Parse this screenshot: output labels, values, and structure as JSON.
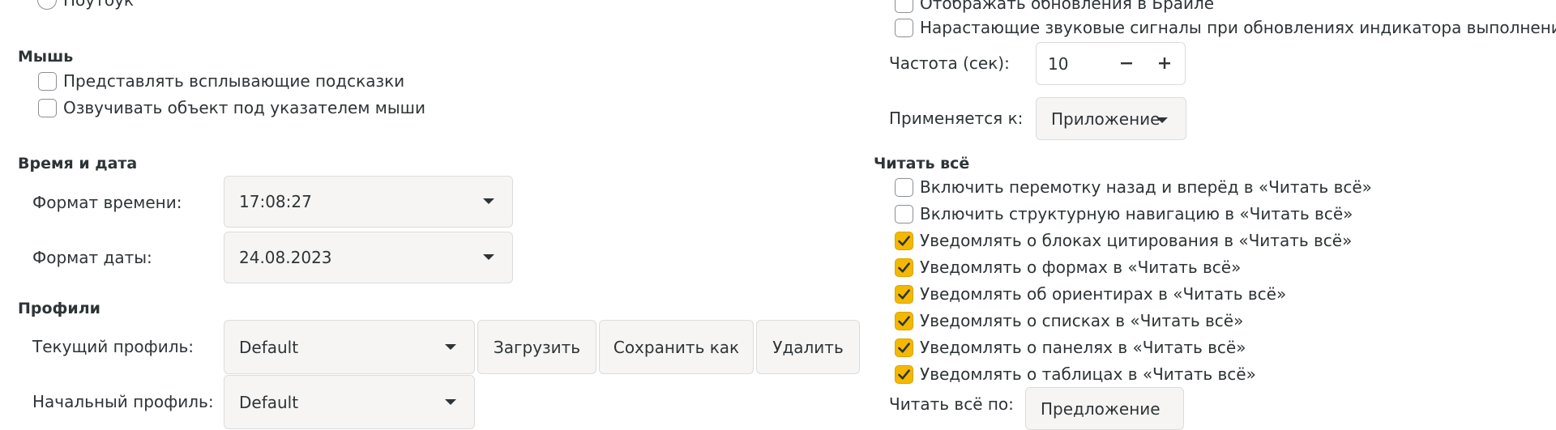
{
  "left": {
    "laptop_radio_label": "Ноутбук",
    "mouse": {
      "heading": "Мышь",
      "tooltips_label": "Представлять всплывающие подсказки",
      "speak_under_pointer_label": "Озвучивать объект под указателем мыши"
    },
    "datetime": {
      "heading": "Время и дата",
      "time_format_label": "Формат времени:",
      "time_format_value": "17:08:27",
      "date_format_label": "Формат даты:",
      "date_format_value": "24.08.2023"
    },
    "profiles": {
      "heading": "Профили",
      "current_label": "Текущий профиль:",
      "current_value": "Default",
      "load_label": "Загрузить",
      "save_as_label": "Сохранить как",
      "delete_label": "Удалить",
      "start_label": "Начальный профиль:",
      "start_value": "Default"
    }
  },
  "right": {
    "braille_updates_label": "Отображать обновления в Брайле",
    "beeps_label": "Нарастающие звуковые сигналы при обновлениях индикатора выполнения",
    "frequency_label": "Частота (сек):",
    "frequency_value": "10",
    "applies_label": "Применяется к:",
    "applies_value": "Приложение",
    "say_all": {
      "heading": "Читать всё",
      "items": [
        {
          "label": "Включить перемотку назад и вперёд в «Читать всё»",
          "checked": false
        },
        {
          "label": "Включить структурную навигацию в «Читать всё»",
          "checked": false
        },
        {
          "label": "Уведомлять о блоках цитирования в «Читать всё»",
          "checked": true
        },
        {
          "label": "Уведомлять о формах в «Читать всё»",
          "checked": true
        },
        {
          "label": "Уведомлять об ориентирах в «Читать всё»",
          "checked": true
        },
        {
          "label": "Уведомлять о списках в «Читать всё»",
          "checked": true
        },
        {
          "label": "Уведомлять о панелях в «Читать всё»",
          "checked": true
        },
        {
          "label": "Уведомлять о таблицах в «Читать всё»",
          "checked": true
        }
      ],
      "by_label": "Читать всё по:",
      "by_value": "Предложение"
    }
  },
  "colors": {
    "accent": "#f5b800",
    "text": "#2e3436",
    "button_bg": "#f6f5f4"
  },
  "icons": {
    "checkbox_checked": "checkmark-icon",
    "combo_arrow": "chevron-down-icon",
    "spin_minus": "minus-icon",
    "spin_plus": "plus-icon"
  }
}
